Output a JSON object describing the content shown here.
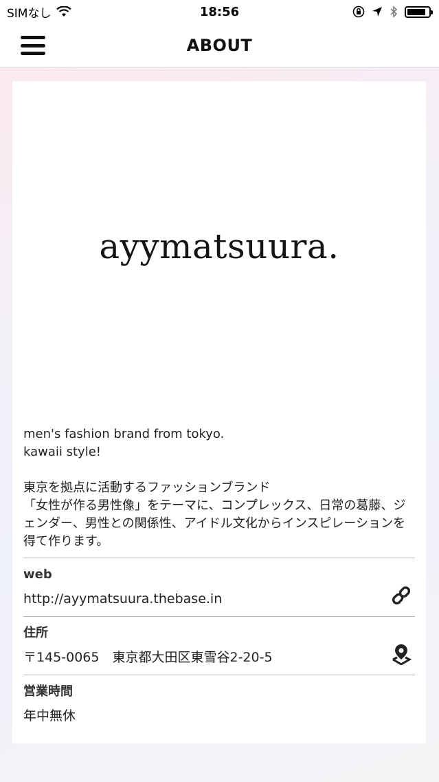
{
  "status_bar": {
    "carrier": "SIMなし",
    "time": "18:56",
    "battery_level": 0.85
  },
  "nav": {
    "title": "ABOUT",
    "menu_icon": "hamburger-menu-icon"
  },
  "logo": {
    "text": "ayymatsuura."
  },
  "description": {
    "en_line1": "men's fashion brand from tokyo.",
    "en_line2": "kawaii style!",
    "ja_line1": "東京を拠点に活動するファッションブランド",
    "ja_line2": "「女性が作る男性像」をテーマに、コンプレックス、日常の葛藤、ジェンダー、男性との関係性、アイドル文化からインスピレーションを得て作ります。"
  },
  "info": {
    "web_label": "web",
    "web_value": "http://ayymatsuura.thebase.in",
    "web_icon": "link-icon",
    "address_label": "住所",
    "address_value": "〒145-0065　東京都大田区東雪谷2-20-5",
    "address_icon": "map-pin-icon",
    "hours_label": "営業時間",
    "hours_value": "年中無休"
  }
}
